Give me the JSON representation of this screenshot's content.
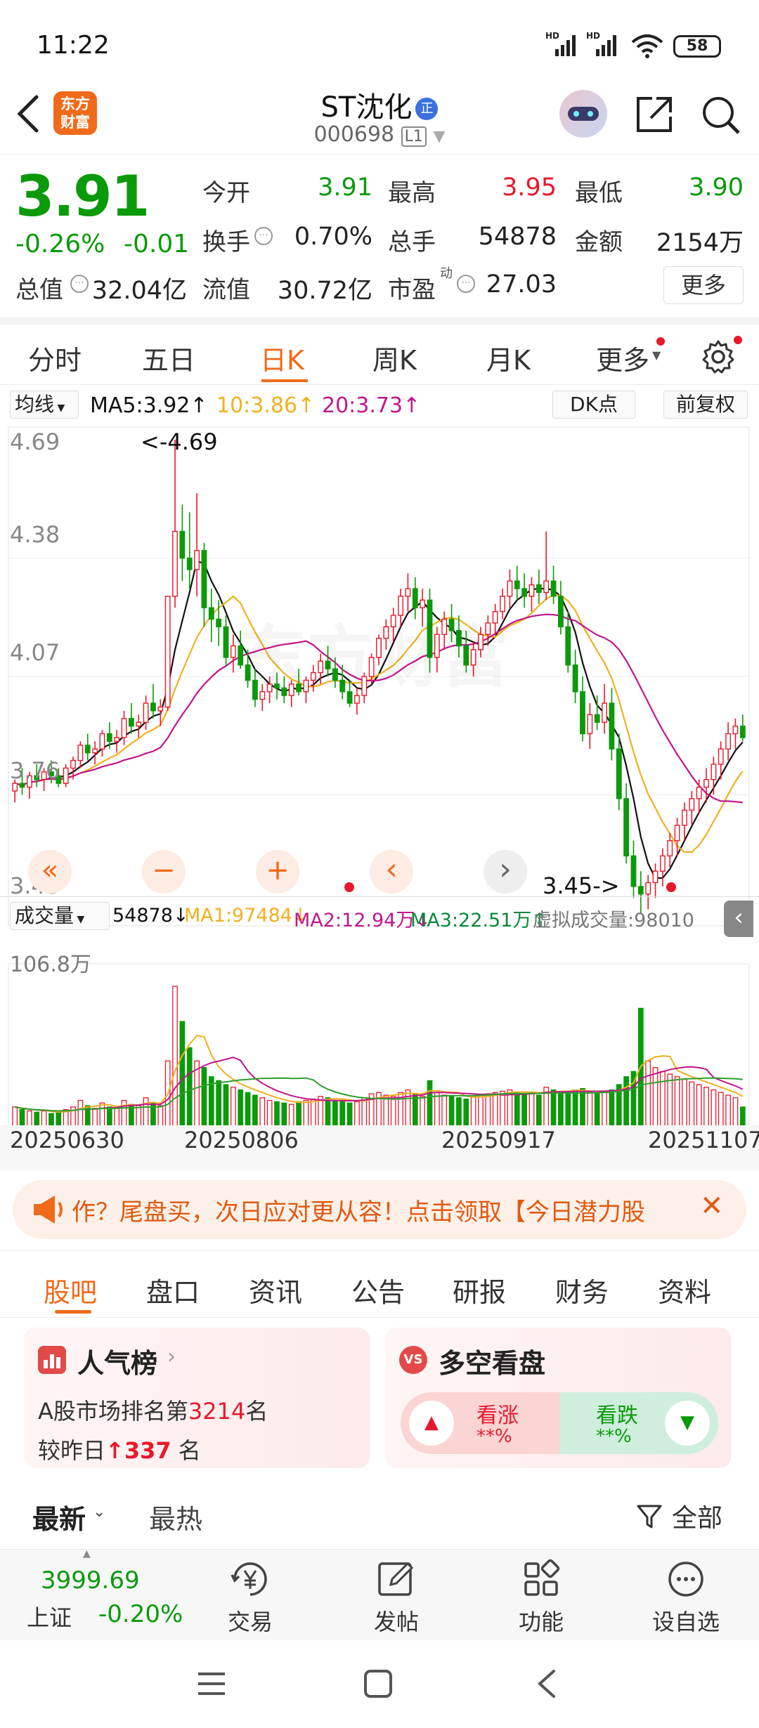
{
  "status_bar": {
    "time": "11:22",
    "signal1": "HD",
    "signal2": "HD",
    "battery": "58"
  },
  "header": {
    "logo_text_line1": "东方",
    "logo_text_line2": "财富",
    "stock_name": "ST沈化",
    "badge": "正",
    "stock_code": "000698",
    "level": "L1"
  },
  "quote": {
    "price": "3.91",
    "change_pct": "-0.26%",
    "change": "-0.01",
    "open_label": "今开",
    "open": "3.91",
    "high_label": "最高",
    "high": "3.95",
    "low_label": "最低",
    "low": "3.90",
    "turnover_label": "换手",
    "turnover": "0.70%",
    "volume_label": "总手",
    "volume": "54878",
    "amount_label": "金额",
    "amount": "2154万",
    "total_cap_label": "总值",
    "total_cap": "32.04亿",
    "float_cap_label": "流值",
    "float_cap": "30.72亿",
    "pe_label": "市盈",
    "pe_sup": "动",
    "pe": "27.03",
    "more_button": "更多"
  },
  "period_tabs": {
    "items": [
      "分时",
      "五日",
      "日K",
      "周K",
      "月K",
      "更多"
    ],
    "active": "日K"
  },
  "chart_toolbar": {
    "indicator": "均线",
    "ma5": "MA5:3.92",
    "ma10": "10:3.86",
    "ma20": "20:3.73",
    "dk": "DK点",
    "adjust": "前复权"
  },
  "volume_toolbar": {
    "indicator": "成交量",
    "vol": "54878",
    "ma1": "MA1:97484",
    "ma2": "MA2:12.94万",
    "ma3": "MA3:22.51万",
    "virtual": "虚拟成交量:98010"
  },
  "colors": {
    "up": "#e8182c",
    "down": "#0a9a0a",
    "ma5": "#111111",
    "ma10": "#f0b020",
    "ma20": "#c0168c",
    "ma60": "#2ca02c",
    "accent": "#f06a1a"
  },
  "chart_data": {
    "type": "candlestick",
    "price_axis_labels": [
      "4.69",
      "4.38",
      "4.07",
      "3.76",
      "3.45"
    ],
    "ylim": [
      3.45,
      4.69
    ],
    "max_marker": "<-4.69",
    "min_marker": "3.45->",
    "date_labels": [
      "20250630",
      "20250806",
      "20250917",
      "20251107"
    ],
    "volume_axis_label": "106.8万",
    "volume_ylim": [
      0,
      1068000
    ],
    "candles": [
      [
        3.77,
        3.8,
        3.74,
        3.79
      ],
      [
        3.79,
        3.83,
        3.76,
        3.78
      ],
      [
        3.78,
        3.82,
        3.75,
        3.81
      ],
      [
        3.81,
        3.84,
        3.78,
        3.8
      ],
      [
        3.8,
        3.83,
        3.77,
        3.82
      ],
      [
        3.82,
        3.85,
        3.79,
        3.81
      ],
      [
        3.81,
        3.83,
        3.78,
        3.79
      ],
      [
        3.79,
        3.84,
        3.78,
        3.83
      ],
      [
        3.83,
        3.86,
        3.8,
        3.85
      ],
      [
        3.85,
        3.9,
        3.83,
        3.89
      ],
      [
        3.89,
        3.92,
        3.85,
        3.87
      ],
      [
        3.87,
        3.9,
        3.84,
        3.88
      ],
      [
        3.88,
        3.93,
        3.86,
        3.92
      ],
      [
        3.92,
        3.95,
        3.88,
        3.9
      ],
      [
        3.9,
        3.93,
        3.87,
        3.91
      ],
      [
        3.91,
        3.98,
        3.89,
        3.96
      ],
      [
        3.96,
        4.0,
        3.92,
        3.94
      ],
      [
        3.94,
        3.97,
        3.91,
        3.95
      ],
      [
        3.95,
        4.02,
        3.93,
        4.0
      ],
      [
        4.0,
        4.05,
        3.96,
        3.98
      ],
      [
        3.98,
        4.01,
        3.94,
        3.99
      ],
      [
        3.99,
        4.28,
        3.98,
        4.28
      ],
      [
        4.28,
        4.69,
        4.25,
        4.45
      ],
      [
        4.45,
        4.52,
        4.32,
        4.38
      ],
      [
        4.38,
        4.5,
        4.3,
        4.35
      ],
      [
        4.35,
        4.55,
        4.28,
        4.4
      ],
      [
        4.4,
        4.42,
        4.2,
        4.25
      ],
      [
        4.25,
        4.3,
        4.16,
        4.22
      ],
      [
        4.22,
        4.27,
        4.15,
        4.2
      ],
      [
        4.2,
        4.23,
        4.1,
        4.12
      ],
      [
        4.12,
        4.18,
        4.08,
        4.15
      ],
      [
        4.15,
        4.19,
        4.09,
        4.1
      ],
      [
        4.1,
        4.14,
        4.04,
        4.06
      ],
      [
        4.06,
        4.09,
        3.99,
        4.01
      ],
      [
        4.01,
        4.05,
        3.98,
        4.03
      ],
      [
        4.03,
        4.07,
        4.0,
        4.05
      ],
      [
        4.05,
        4.08,
        4.01,
        4.04
      ],
      [
        4.04,
        4.07,
        4.0,
        4.02
      ],
      [
        4.02,
        4.06,
        3.99,
        4.05
      ],
      [
        4.05,
        4.09,
        4.02,
        4.03
      ],
      [
        4.03,
        4.07,
        4.0,
        4.06
      ],
      [
        4.06,
        4.1,
        4.03,
        4.08
      ],
      [
        4.08,
        4.13,
        4.05,
        4.11
      ],
      [
        4.11,
        4.15,
        4.07,
        4.09
      ],
      [
        4.09,
        4.12,
        4.04,
        4.06
      ],
      [
        4.06,
        4.1,
        4.01,
        4.03
      ],
      [
        4.03,
        4.06,
        3.99,
        4.0
      ],
      [
        4.0,
        4.04,
        3.97,
        4.02
      ],
      [
        4.02,
        4.08,
        4.0,
        4.07
      ],
      [
        4.07,
        4.13,
        4.05,
        4.12
      ],
      [
        4.12,
        4.18,
        4.1,
        4.17
      ],
      [
        4.17,
        4.22,
        4.14,
        4.2
      ],
      [
        4.2,
        4.25,
        4.16,
        4.23
      ],
      [
        4.23,
        4.3,
        4.2,
        4.28
      ],
      [
        4.28,
        4.34,
        4.24,
        4.3
      ],
      [
        4.3,
        4.33,
        4.22,
        4.25
      ],
      [
        4.25,
        4.3,
        4.2,
        4.27
      ],
      [
        4.27,
        4.3,
        4.08,
        4.12
      ],
      [
        4.12,
        4.2,
        4.08,
        4.18
      ],
      [
        4.18,
        4.24,
        4.14,
        4.22
      ],
      [
        4.22,
        4.26,
        4.16,
        4.19
      ],
      [
        4.19,
        4.23,
        4.12,
        4.15
      ],
      [
        4.15,
        4.19,
        4.08,
        4.1
      ],
      [
        4.1,
        4.16,
        4.07,
        4.14
      ],
      [
        4.14,
        4.2,
        4.12,
        4.18
      ],
      [
        4.18,
        4.23,
        4.15,
        4.21
      ],
      [
        4.21,
        4.26,
        4.18,
        4.24
      ],
      [
        4.24,
        4.3,
        4.22,
        4.28
      ],
      [
        4.28,
        4.35,
        4.25,
        4.32
      ],
      [
        4.32,
        4.36,
        4.27,
        4.3
      ],
      [
        4.3,
        4.34,
        4.25,
        4.28
      ],
      [
        4.28,
        4.33,
        4.24,
        4.31
      ],
      [
        4.31,
        4.35,
        4.26,
        4.29
      ],
      [
        4.29,
        4.45,
        4.27,
        4.32
      ],
      [
        4.32,
        4.36,
        4.26,
        4.28
      ],
      [
        4.28,
        4.32,
        4.18,
        4.2
      ],
      [
        4.2,
        4.24,
        4.08,
        4.1
      ],
      [
        4.1,
        4.14,
        4.0,
        4.03
      ],
      [
        4.03,
        4.07,
        3.9,
        3.92
      ],
      [
        3.92,
        4.0,
        3.88,
        3.97
      ],
      [
        3.97,
        4.02,
        3.93,
        3.95
      ],
      [
        3.95,
        4.05,
        3.92,
        4.0
      ],
      [
        4.0,
        4.04,
        3.85,
        3.88
      ],
      [
        3.88,
        3.92,
        3.72,
        3.75
      ],
      [
        3.75,
        3.79,
        3.58,
        3.6
      ],
      [
        3.6,
        3.64,
        3.49,
        3.52
      ],
      [
        3.52,
        3.56,
        3.45,
        3.5
      ],
      [
        3.5,
        3.55,
        3.46,
        3.53
      ],
      [
        3.53,
        3.58,
        3.49,
        3.56
      ],
      [
        3.56,
        3.62,
        3.52,
        3.6
      ],
      [
        3.6,
        3.66,
        3.57,
        3.64
      ],
      [
        3.64,
        3.7,
        3.6,
        3.68
      ],
      [
        3.68,
        3.74,
        3.64,
        3.72
      ],
      [
        3.72,
        3.77,
        3.68,
        3.75
      ],
      [
        3.75,
        3.8,
        3.71,
        3.78
      ],
      [
        3.78,
        3.83,
        3.74,
        3.8
      ],
      [
        3.8,
        3.86,
        3.76,
        3.84
      ],
      [
        3.84,
        3.9,
        3.8,
        3.88
      ],
      [
        3.88,
        3.95,
        3.85,
        3.92
      ],
      [
        3.92,
        3.96,
        3.88,
        3.94
      ],
      [
        3.94,
        3.97,
        3.9,
        3.91
      ]
    ],
    "volumes": [
      150000,
      130000,
      120000,
      110000,
      120000,
      100000,
      110000,
      130000,
      150000,
      200000,
      160000,
      140000,
      180000,
      150000,
      140000,
      200000,
      170000,
      160000,
      220000,
      180000,
      160000,
      500000,
      1068000,
      800000,
      600000,
      500000,
      450000,
      380000,
      350000,
      320000,
      300000,
      280000,
      260000,
      240000,
      220000,
      200000,
      190000,
      180000,
      170000,
      190000,
      200000,
      210000,
      230000,
      220000,
      200000,
      190000,
      180000,
      190000,
      220000,
      250000,
      260000,
      240000,
      230000,
      260000,
      280000,
      250000,
      230000,
      350000,
      260000,
      240000,
      230000,
      220000,
      210000,
      230000,
      240000,
      250000,
      260000,
      270000,
      280000,
      260000,
      250000,
      260000,
      240000,
      300000,
      280000,
      260000,
      270000,
      280000,
      290000,
      260000,
      250000,
      270000,
      280000,
      320000,
      380000,
      420000,
      900000,
      500000,
      450000,
      420000,
      400000,
      380000,
      360000,
      340000,
      320000,
      300000,
      280000,
      260000,
      240000,
      220000,
      150000
    ]
  },
  "chart_controls": {
    "left": "«",
    "minus": "−",
    "plus": "+",
    "prev": "‹",
    "next": "›"
  },
  "promo": {
    "text": "作？尾盘买，次日应对更从容！点击领取【今日潜力股",
    "close": "✕"
  },
  "sub_tabs": {
    "items": [
      "股吧",
      "盘口",
      "资讯",
      "公告",
      "研报",
      "财务",
      "资料"
    ],
    "active": "股吧"
  },
  "popularity_card": {
    "title": "人气榜",
    "rank_text_prefix": "A股市场排名第",
    "rank": "3214",
    "rank_suffix": "名",
    "change_prefix": "较昨日",
    "change": "337",
    "change_suffix": "名"
  },
  "sentiment_card": {
    "title": "多空看盘",
    "bull_label": "看涨",
    "bull_value": "**%",
    "bear_label": "看跌",
    "bear_value": "**%"
  },
  "sort_bar": {
    "latest": "最新",
    "hottest": "最热",
    "filter": "全部"
  },
  "bottom_nav": {
    "index_value": "3999.69",
    "index_name": "上证",
    "index_change": "-0.20%",
    "items": [
      "交易",
      "发帖",
      "功能",
      "设自选"
    ]
  }
}
